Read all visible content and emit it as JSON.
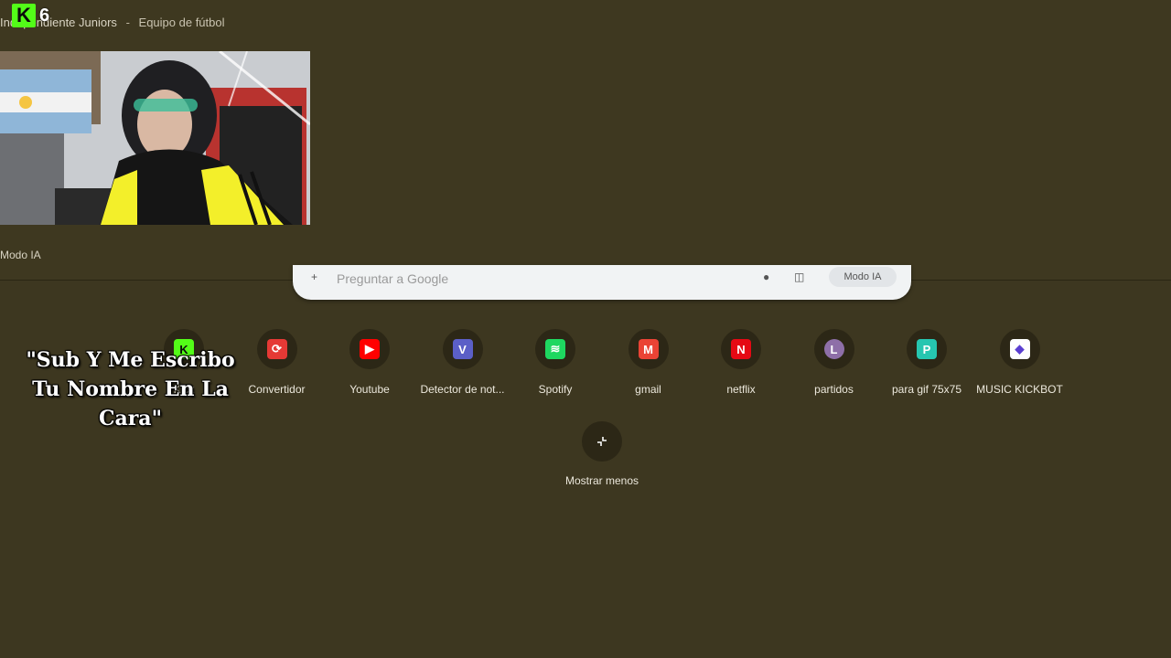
{
  "breadcrumb": {
    "team": "Independiente Juniors",
    "separator": "-",
    "category": "Equipo de fútbol"
  },
  "stream": {
    "platform_icon": "kick-icon",
    "platform_letter": "K",
    "viewer_count": "6",
    "overlay_line1": "\"Sub Y Me Escribo",
    "overlay_line2": "Tu Nombre En La Cara\""
  },
  "ai_mode_label": "Modo IA",
  "search": {
    "placeholder": "Preguntar a Google",
    "ai_mode_button": "Modo IA"
  },
  "shortcuts": [
    {
      "label": "Kick",
      "icon": "kick-icon",
      "color": "#53fc18",
      "letter": "K"
    },
    {
      "label": "Convertidor",
      "icon": "converter-icon",
      "color": "#e53935",
      "letter": "⟳"
    },
    {
      "label": "Youtube",
      "icon": "youtube-icon",
      "color": "#ff0000",
      "letter": "▶"
    },
    {
      "label": "Detector de not...",
      "icon": "v-icon",
      "color": "#5b5fc7",
      "letter": "V"
    },
    {
      "label": "Spotify",
      "icon": "spotify-icon",
      "color": "#1ed760",
      "letter": "≋"
    },
    {
      "label": "gmail",
      "icon": "gmail-icon",
      "color": "#ea4335",
      "letter": "M"
    },
    {
      "label": "netflix",
      "icon": "netflix-icon",
      "color": "#e50914",
      "letter": "N"
    },
    {
      "label": "partidos",
      "icon": "letter-l-icon",
      "color": "#8e6fa8",
      "letter": "L"
    },
    {
      "label": "para gif 75x75",
      "icon": "gif-icon",
      "color": "#26c6b0",
      "letter": "P"
    },
    {
      "label": "MUSIC KICKBOT",
      "icon": "kickbot-icon",
      "color": "#ffffff",
      "letter": "◆"
    }
  ],
  "show_less": {
    "label": "Mostrar menos",
    "icon": "collapse-icon"
  }
}
